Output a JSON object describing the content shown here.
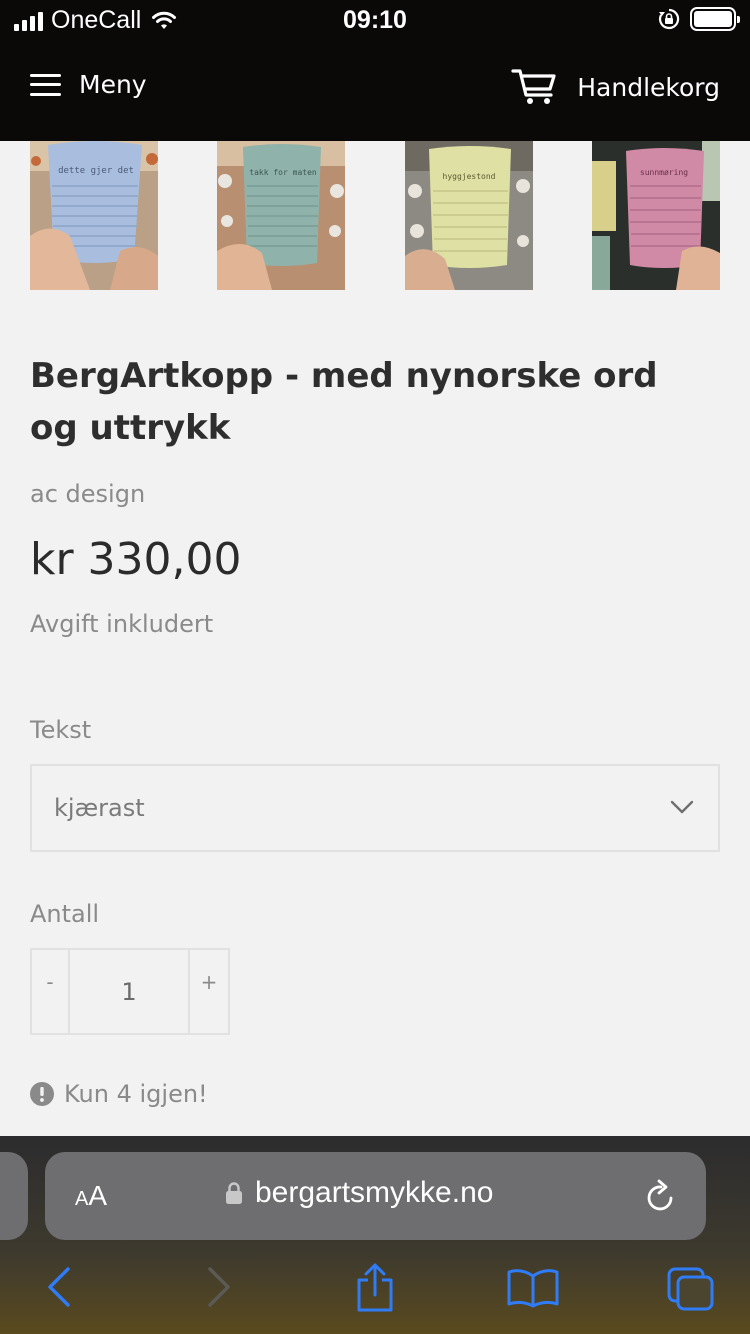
{
  "status_bar": {
    "carrier": "OneCall",
    "time": "09:10"
  },
  "header": {
    "menu_label": "Meny",
    "cart_label": "Handlekorg"
  },
  "thumbnails": [
    {
      "mug_text": "dette gjer det",
      "mug_color": "#a9bede"
    },
    {
      "mug_text": "takk for maten",
      "mug_color": "#8fb2aa"
    },
    {
      "mug_text": "hyggjestond",
      "mug_color": "#dfe0a4"
    },
    {
      "mug_text": "sunnmøring",
      "mug_color": "#d08aa6"
    }
  ],
  "product": {
    "title": "BergArtkopp - med nynorske ord og uttrykk",
    "vendor": "ac design",
    "price": "kr 330,00",
    "tax_note": "Avgift inkludert"
  },
  "variant": {
    "label": "Tekst",
    "selected": "kjærast"
  },
  "quantity": {
    "label": "Antall",
    "minus": "-",
    "value": "1",
    "plus": "+"
  },
  "stock": {
    "message": "Kun 4 igjen!"
  },
  "browser": {
    "aa_small": "A",
    "aa_big": "A",
    "url": "bergartsmykke.no"
  },
  "colors": {
    "header_bg": "#0b0808",
    "page_bg": "#f2f2f2",
    "ios_blue": "#2f7cf6"
  }
}
